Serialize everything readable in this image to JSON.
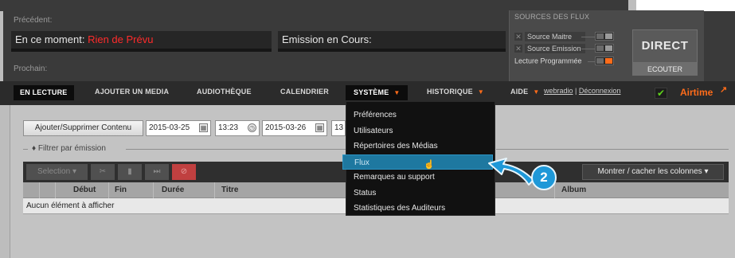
{
  "status": {
    "previous_label": "Précédent:",
    "now_label": "En ce moment:",
    "now_value": "Rien de Prévu",
    "show_label": "Emission en Cours:",
    "next_label": "Prochain:"
  },
  "sources": {
    "title": "SOURCES DES FLUX",
    "master": "Source Maitre",
    "show": "Source Emission",
    "scheduled": "Lecture Programmée",
    "direct": "DIRECT",
    "listen": "ECOUTER"
  },
  "nav": {
    "items": [
      "EN LECTURE",
      "AJOUTER UN MEDIA",
      "AUDIOTHÈQUE",
      "CALENDRIER",
      "SYSTÈME",
      "HISTORIQUE",
      "AIDE"
    ],
    "user": "webradio",
    "separator": "|",
    "logout": "Déconnexion",
    "brand": "Airtime"
  },
  "content": {
    "add_remove_button": "Ajouter/Supprimer Contenu",
    "start_date": "2015-03-25",
    "start_time": "13:23",
    "end_date": "2015-03-26",
    "end_time_partial": "13",
    "filter_label": "Filtrer par émission",
    "selection_label": "Selection",
    "toggle_columns": "Montrer / cacher les colonnes",
    "columns": [
      "Début",
      "Fin",
      "Durée",
      "Titre",
      "Album"
    ],
    "empty_message": "Aucun élément à afficher"
  },
  "dropdown": {
    "items": [
      "Préférences",
      "Utilisateurs",
      "Répertoires des Médias",
      "Flux",
      "Remarques au support",
      "Status",
      "Statistiques des Auditeurs"
    ],
    "highlighted": "Flux"
  },
  "callout": {
    "number": "2"
  },
  "colors": {
    "accent": "#ff6c1a",
    "highlight": "#1e78a0",
    "callout": "#1e98d8",
    "live_text": "#ff2b2b"
  },
  "icons": {
    "calendar": "calendar-icon",
    "clock": "clock-icon",
    "check": "check-icon",
    "cursor": "hand-cursor-icon"
  }
}
